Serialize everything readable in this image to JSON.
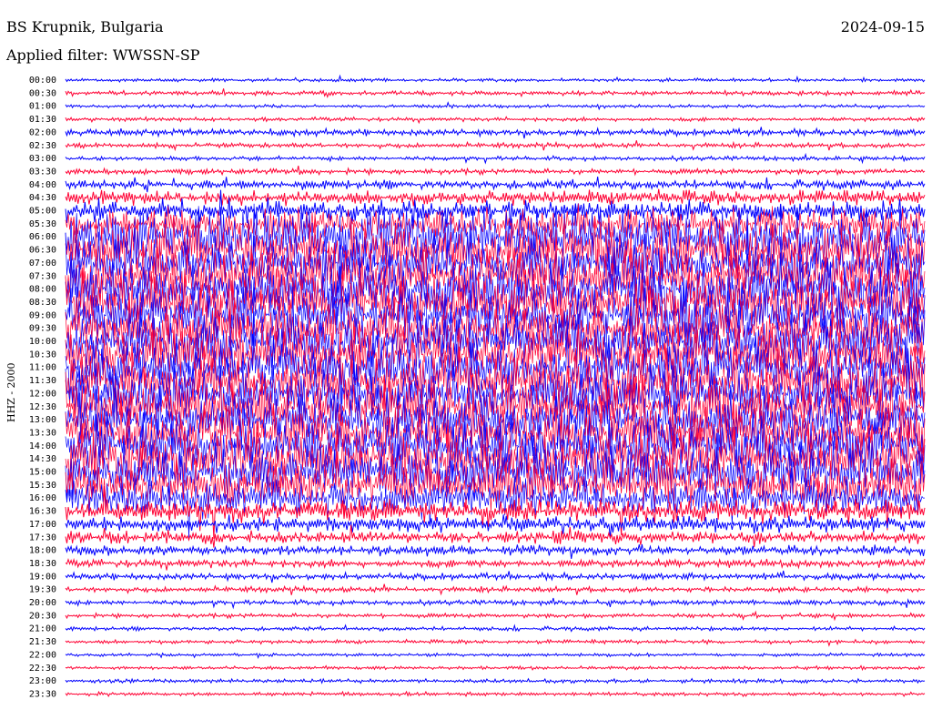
{
  "header": {
    "station": "BS Krupnik, Bulgaria",
    "date": "2024-09-15",
    "filter": "Applied filter: WWSSN-SP"
  },
  "chart_data": {
    "type": "line",
    "title": "BS Krupnik, Bulgaria",
    "subtitle": "Applied filter: WWSSN-SP",
    "date": "2024-09-15",
    "ylabel": "HHZ - 2000",
    "xlabel": "",
    "trace_colors": [
      "#0000ff",
      "#ff0033"
    ],
    "y_tick_labels": [
      "00:00",
      "00:30",
      "01:00",
      "01:30",
      "02:00",
      "02:30",
      "03:00",
      "03:30",
      "04:00",
      "04:30",
      "05:00",
      "05:30",
      "06:00",
      "06:30",
      "07:00",
      "07:30",
      "08:00",
      "08:30",
      "09:00",
      "09:30",
      "10:00",
      "10:30",
      "11:00",
      "11:30",
      "12:00",
      "12:30",
      "13:00",
      "13:30",
      "14:00",
      "14:30",
      "15:00",
      "15:30",
      "16:00",
      "16:30",
      "17:00",
      "17:30",
      "18:00",
      "18:30",
      "19:00",
      "19:30",
      "20:00",
      "20:30",
      "21:00",
      "21:30",
      "22:00",
      "22:30",
      "23:00",
      "23:30"
    ],
    "series": [
      {
        "row_start": "00:00",
        "activity": 0.02
      },
      {
        "row_start": "00:30",
        "activity": 0.04
      },
      {
        "row_start": "01:00",
        "activity": 0.02
      },
      {
        "row_start": "01:30",
        "activity": 0.03
      },
      {
        "row_start": "02:00",
        "activity": 0.08
      },
      {
        "row_start": "02:30",
        "activity": 0.05
      },
      {
        "row_start": "03:00",
        "activity": 0.04
      },
      {
        "row_start": "03:30",
        "activity": 0.06
      },
      {
        "row_start": "04:00",
        "activity": 0.12
      },
      {
        "row_start": "04:30",
        "activity": 0.22
      },
      {
        "row_start": "05:00",
        "activity": 0.35
      },
      {
        "row_start": "05:30",
        "activity": 0.55
      },
      {
        "row_start": "06:00",
        "activity": 1.0
      },
      {
        "row_start": "06:30",
        "activity": 1.0
      },
      {
        "row_start": "07:00",
        "activity": 1.0
      },
      {
        "row_start": "07:30",
        "activity": 1.0
      },
      {
        "row_start": "08:00",
        "activity": 1.0
      },
      {
        "row_start": "08:30",
        "activity": 1.0
      },
      {
        "row_start": "09:00",
        "activity": 1.0
      },
      {
        "row_start": "09:30",
        "activity": 1.0
      },
      {
        "row_start": "10:00",
        "activity": 1.0
      },
      {
        "row_start": "10:30",
        "activity": 1.0
      },
      {
        "row_start": "11:00",
        "activity": 1.0
      },
      {
        "row_start": "11:30",
        "activity": 1.0
      },
      {
        "row_start": "12:00",
        "activity": 1.0
      },
      {
        "row_start": "12:30",
        "activity": 1.0
      },
      {
        "row_start": "13:00",
        "activity": 1.0
      },
      {
        "row_start": "13:30",
        "activity": 1.0
      },
      {
        "row_start": "14:00",
        "activity": 1.0
      },
      {
        "row_start": "14:30",
        "activity": 1.0
      },
      {
        "row_start": "15:00",
        "activity": 1.0
      },
      {
        "row_start": "15:30",
        "activity": 0.9
      },
      {
        "row_start": "16:00",
        "activity": 0.6
      },
      {
        "row_start": "16:30",
        "activity": 0.35
      },
      {
        "row_start": "17:00",
        "activity": 0.25
      },
      {
        "row_start": "17:30",
        "activity": 0.18
      },
      {
        "row_start": "18:00",
        "activity": 0.14
      },
      {
        "row_start": "18:30",
        "activity": 0.1
      },
      {
        "row_start": "19:00",
        "activity": 0.08
      },
      {
        "row_start": "19:30",
        "activity": 0.06
      },
      {
        "row_start": "20:00",
        "activity": 0.05
      },
      {
        "row_start": "20:30",
        "activity": 0.04
      },
      {
        "row_start": "21:00",
        "activity": 0.03
      },
      {
        "row_start": "21:30",
        "activity": 0.03
      },
      {
        "row_start": "22:00",
        "activity": 0.02
      },
      {
        "row_start": "22:30",
        "activity": 0.02
      },
      {
        "row_start": "23:00",
        "activity": 0.03
      },
      {
        "row_start": "23:30",
        "activity": 0.03
      }
    ]
  }
}
